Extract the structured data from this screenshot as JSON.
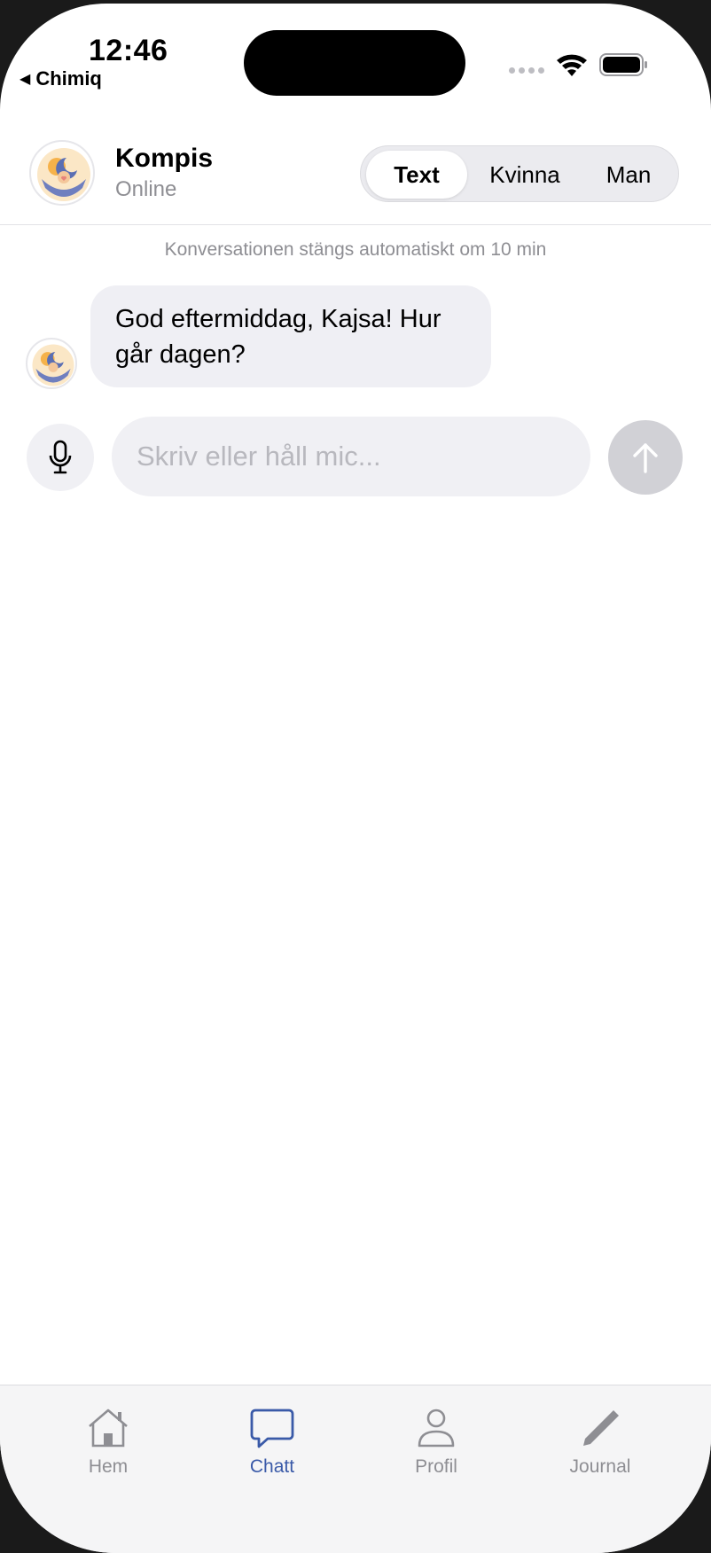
{
  "status_bar": {
    "time": "12:46",
    "back_app": "Chimiq"
  },
  "header": {
    "bot_name": "Kompis",
    "bot_status": "Online",
    "voice_modes": [
      {
        "label": "Text",
        "active": true
      },
      {
        "label": "Kvinna",
        "active": false
      },
      {
        "label": "Man",
        "active": false
      }
    ]
  },
  "chat": {
    "notice": "Konversationen stängs automatiskt om 10 min",
    "messages": [
      {
        "sender": "bot",
        "text": "God eftermiddag, Kajsa! Hur går dagen?"
      }
    ]
  },
  "composer": {
    "placeholder": "Skriv eller håll mic...",
    "value": "",
    "mic_icon": "microphone-icon",
    "send_icon": "arrow-up-icon"
  },
  "tabbar": {
    "tabs": [
      {
        "label": "Hem",
        "icon": "home-icon",
        "active": false
      },
      {
        "label": "Chatt",
        "icon": "chat-bubble-icon",
        "active": true
      },
      {
        "label": "Profil",
        "icon": "person-icon",
        "active": false
      },
      {
        "label": "Journal",
        "icon": "pencil-icon",
        "active": false
      }
    ]
  },
  "colors": {
    "accent": "#3a5aa8",
    "bubble_bg": "#efeff4",
    "muted_text": "#8e8e93",
    "send_disabled": "#d1d1d6"
  }
}
